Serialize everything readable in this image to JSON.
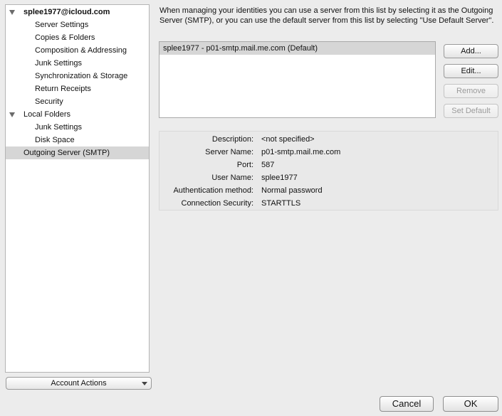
{
  "sidebar": {
    "account": "splee1977@icloud.com",
    "account_items": [
      "Server Settings",
      "Copies & Folders",
      "Composition & Addressing",
      "Junk Settings",
      "Synchronization & Storage",
      "Return Receipts",
      "Security"
    ],
    "local_folders": "Local Folders",
    "local_items": [
      "Junk Settings",
      "Disk Space"
    ],
    "outgoing": "Outgoing Server (SMTP)",
    "account_actions": "Account Actions"
  },
  "main": {
    "intro": "When managing your identities you can use a server from this list by selecting it as the Outgoing Server (SMTP), or you can use the default server from this list by selecting \"Use Default Server\".",
    "servers": [
      "splee1977 - p01-smtp.mail.me.com (Default)"
    ],
    "buttons": {
      "add": "Add...",
      "edit": "Edit...",
      "remove": "Remove",
      "set_default": "Set Default"
    },
    "details": {
      "description_label": "Description:",
      "description_value": "<not specified>",
      "server_name_label": "Server Name:",
      "server_name_value": "p01-smtp.mail.me.com",
      "port_label": "Port:",
      "port_value": "587",
      "user_name_label": "User Name:",
      "user_name_value": "splee1977",
      "auth_label": "Authentication method:",
      "auth_value": "Normal password",
      "security_label": "Connection Security:",
      "security_value": "STARTTLS"
    }
  },
  "footer": {
    "cancel": "Cancel",
    "ok": "OK"
  }
}
